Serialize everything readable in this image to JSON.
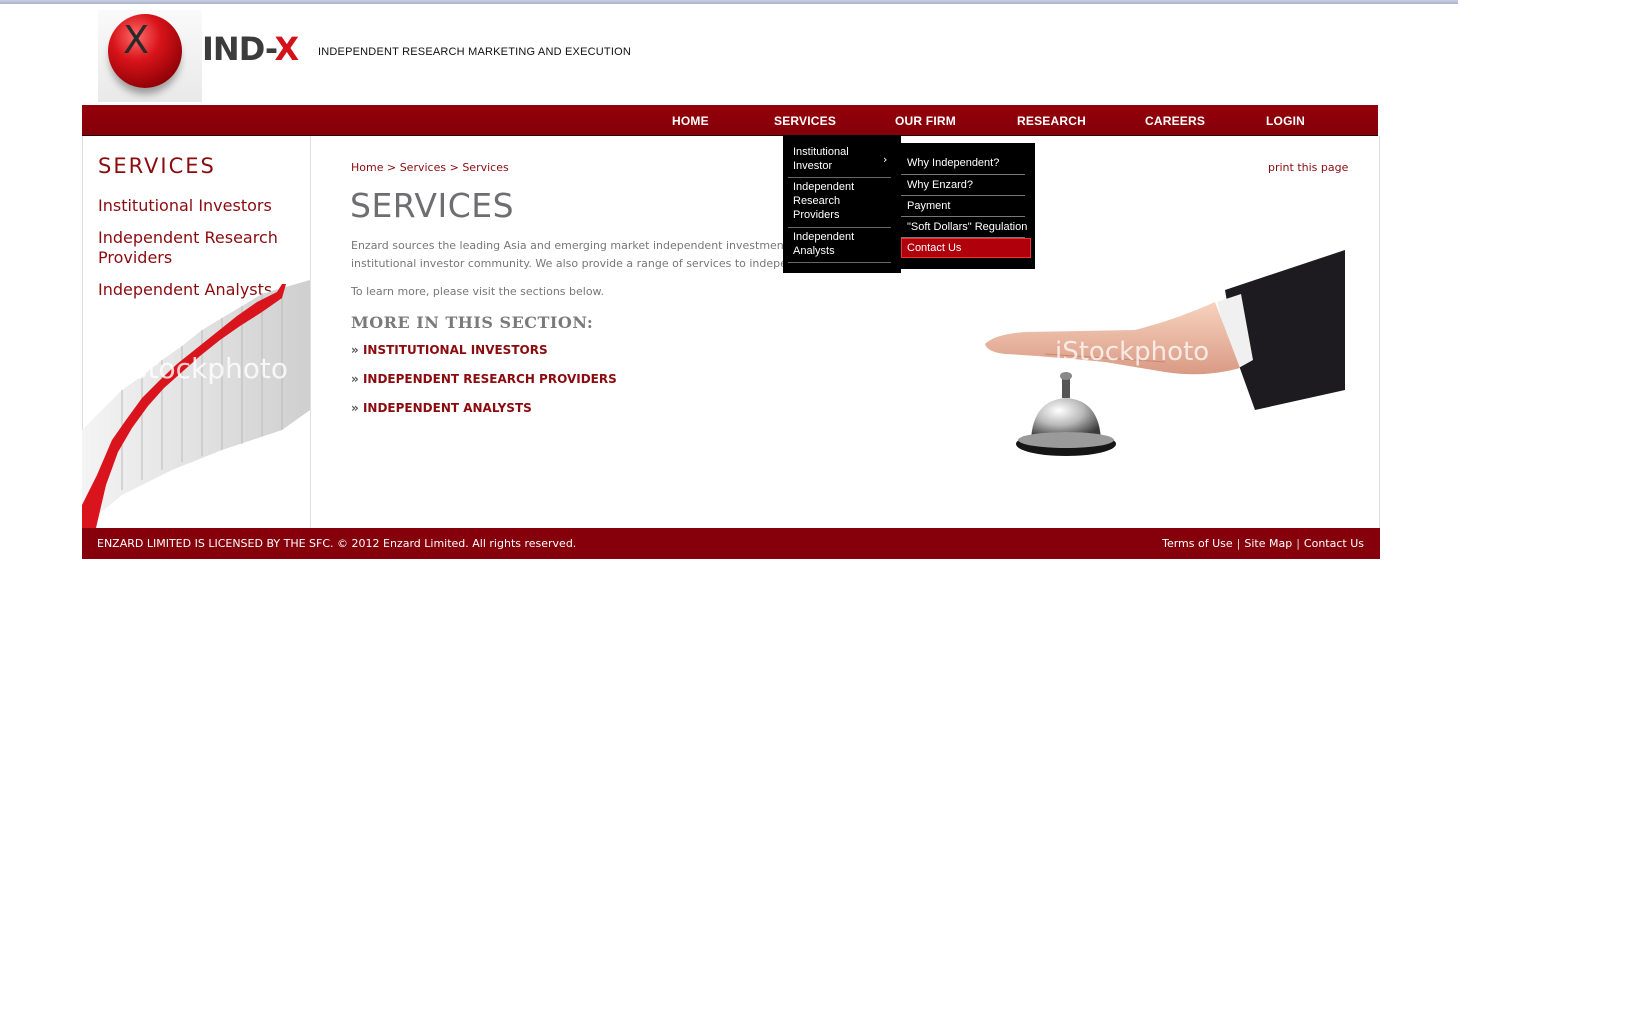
{
  "header": {
    "brand_left": "IND-",
    "brand_right": "X",
    "logo_letter": "X",
    "tagline": "INDEPENDENT RESEARCH MARKETING AND EXECUTION"
  },
  "nav": {
    "items": [
      "HOME",
      "SERVICES",
      "OUR FIRM",
      "RESEARCH",
      "CAREERS",
      "LOGIN"
    ]
  },
  "dropdown": {
    "level1": [
      {
        "label": "Institutional Investor",
        "has_sub": true
      },
      {
        "label": "Independent Research Providers"
      },
      {
        "label": "Independent Analysts"
      }
    ],
    "level2": [
      {
        "label": "Why Independent?"
      },
      {
        "label": "Why Enzard?"
      },
      {
        "label": "Payment"
      },
      {
        "label": "\"Soft Dollars\" Regulation"
      },
      {
        "label": "Contact Us",
        "highlighted": true
      }
    ],
    "chevron": "›"
  },
  "sidebar": {
    "title": "SERVICES",
    "links": [
      "Institutional Investors",
      "Independent Research Providers",
      "Independent Analysts"
    ],
    "watermark": "iStockphoto"
  },
  "content": {
    "breadcrumb": [
      "Home",
      "Services",
      "Services"
    ],
    "breadcrumb_sep": ">",
    "print_link": "print this page",
    "title": "SERVICES",
    "intro_line1": "Enzard sources the leading Asia and emerging market independent investment",
    "intro_line2": "institutional investor community. We also provide a range of services to indepe",
    "learn_more": "To learn more, please visit the sections below.",
    "section_heading": "MORE IN THIS SECTION:",
    "section_links": [
      "INSTITUTIONAL INVESTORS",
      "INDEPENDENT RESEARCH PROVIDERS",
      "INDEPENDENT ANALYSTS"
    ],
    "link_prefix": "»",
    "watermark": "iStockphoto"
  },
  "footer": {
    "copyright": "ENZARD LIMITED IS LICENSED BY THE SFC. © 2012 Enzard Limited. All rights reserved.",
    "links": [
      "Terms of Use",
      "Site Map",
      "Contact Us"
    ],
    "link_sep": "|"
  },
  "colors": {
    "brand_red": "#86000b",
    "link_red": "#8b0b0f",
    "menu_black": "#000000"
  }
}
